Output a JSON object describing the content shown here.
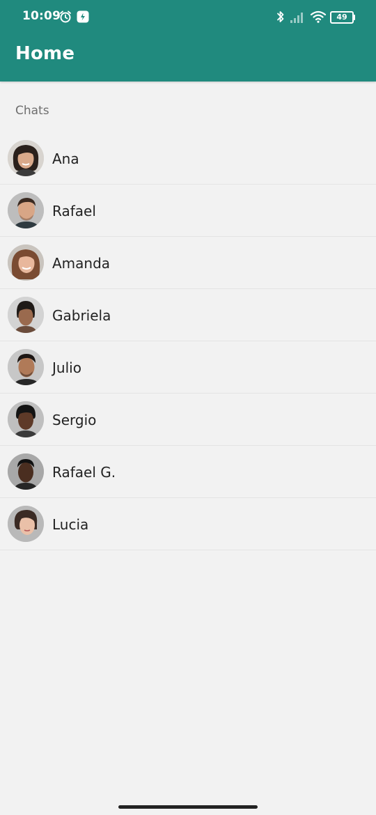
{
  "status_bar": {
    "time": "10:09",
    "battery_level": "49",
    "icons": [
      "alarm-icon",
      "notification-icon",
      "bluetooth-icon",
      "signal-icon",
      "wifi-icon",
      "battery-icon"
    ]
  },
  "app_bar": {
    "title": "Home",
    "color": "#208a7e"
  },
  "section": {
    "label": "Chats"
  },
  "chats": [
    {
      "name": "Ana"
    },
    {
      "name": "Rafael"
    },
    {
      "name": "Amanda"
    },
    {
      "name": "Gabriela"
    },
    {
      "name": "Julio"
    },
    {
      "name": "Sergio"
    },
    {
      "name": "Rafael G."
    },
    {
      "name": "Lucia"
    }
  ]
}
